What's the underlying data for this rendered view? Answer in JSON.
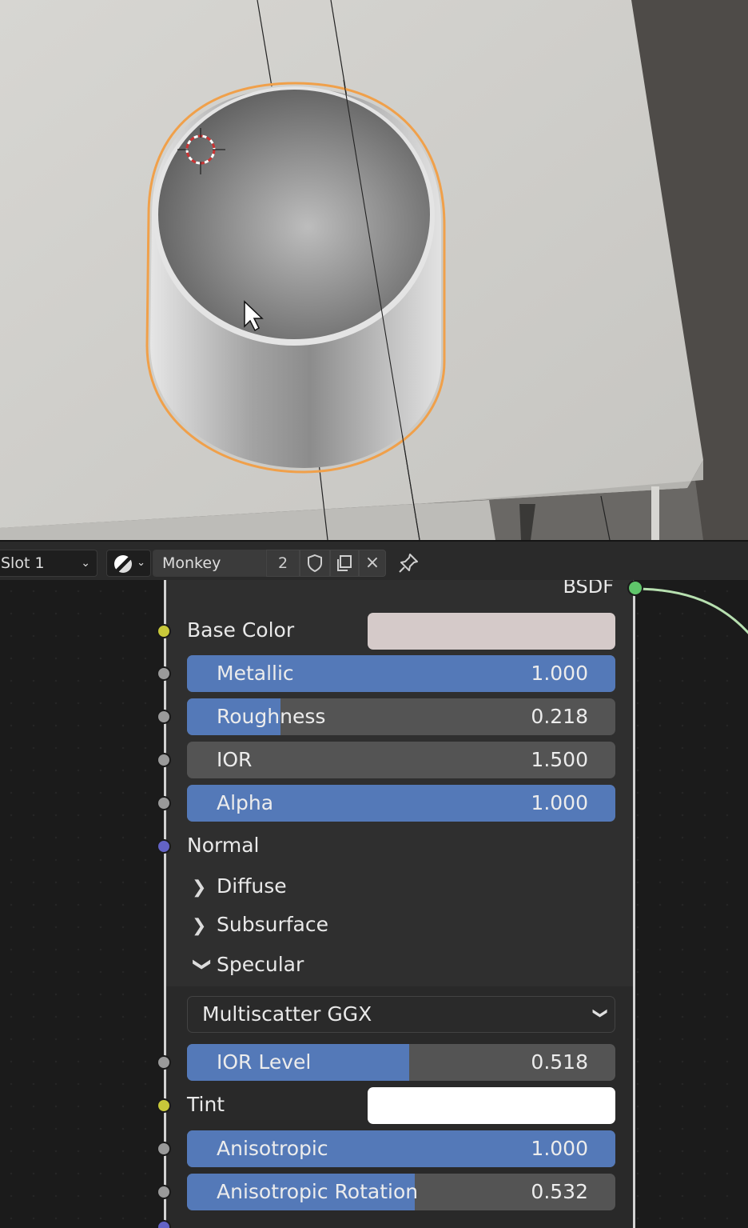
{
  "viewport": {
    "colors": {
      "selection_outline": "#f0a04a",
      "cursor_ring": "#cc3333"
    },
    "icons": [
      "3d-cursor-icon",
      "mouse-pointer-icon"
    ]
  },
  "header": {
    "slot_select": "Slot 1",
    "shading_icon": "material-sphere-icon",
    "material_name": "Monkey",
    "user_count": "2",
    "icons": [
      "shield-fake-user-icon",
      "duplicate-icon",
      "close-icon",
      "pin-icon"
    ]
  },
  "node": {
    "output_label": "BSDF",
    "base_color": {
      "label": "Base Color",
      "color": "#d5cac9"
    },
    "fields": [
      {
        "label": "Metallic",
        "value": "1.000",
        "fill": 1.0
      },
      {
        "label": "Roughness",
        "value": "0.218",
        "fill": 0.218
      },
      {
        "label": "IOR",
        "value": "1.500",
        "fill": 0.0
      },
      {
        "label": "Alpha",
        "value": "1.000",
        "fill": 1.0
      }
    ],
    "normal_label": "Normal",
    "panels": [
      {
        "label": "Diffuse",
        "expanded": false
      },
      {
        "label": "Subsurface",
        "expanded": false
      },
      {
        "label": "Specular",
        "expanded": true
      }
    ],
    "specular": {
      "distribution": "Multiscatter GGX",
      "ior_level": {
        "label": "IOR Level",
        "value": "0.518",
        "fill": 0.518
      },
      "tint": {
        "label": "Tint",
        "color": "#ffffff"
      },
      "anisotropic": {
        "label": "Anisotropic",
        "value": "1.000",
        "fill": 1.0
      },
      "anisotropic_rotation": {
        "label": "Anisotropic Rotation",
        "value": "0.532",
        "fill": 0.532
      }
    },
    "colors": {
      "field_fill": "#5479b8",
      "field_bg": "#545454",
      "socket_float": "#9a9a9a",
      "socket_color": "#c8c83a",
      "socket_vector": "#6363c6",
      "socket_shader": "#5fc46a",
      "link": "#b7e0b0"
    }
  }
}
